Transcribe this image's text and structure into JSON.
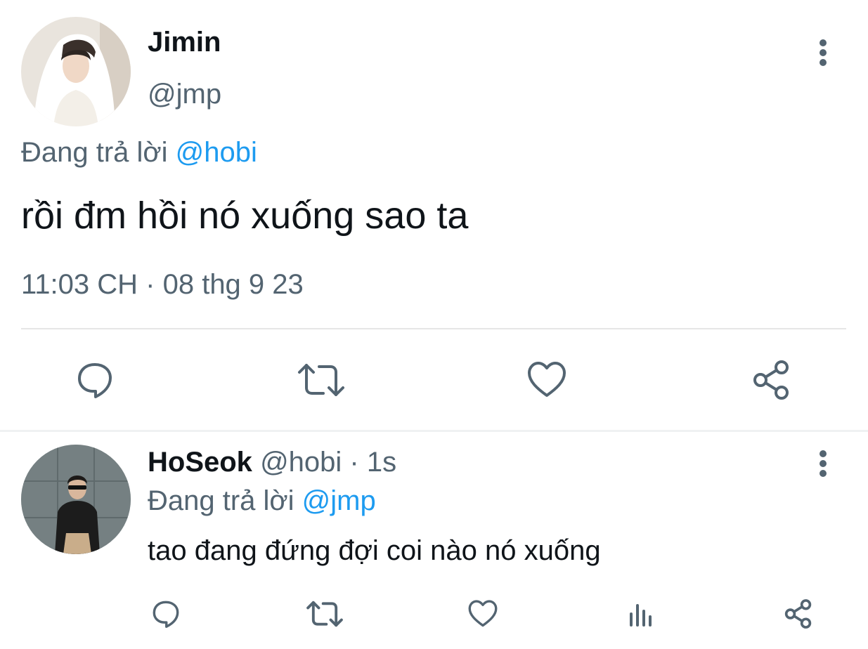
{
  "main_tweet": {
    "author_name": "Jimin",
    "handle": "@jmp",
    "reply_prefix": "Đang trả lời",
    "reply_to": "@hobi",
    "text": "rồi đm hồi nó xuống sao ta",
    "time": "11:03 CH",
    "separator": "·",
    "date": "08 thg 9 23",
    "actions": [
      "reply-icon",
      "retweet-icon",
      "like-icon",
      "share-icon"
    ]
  },
  "reply_tweet": {
    "author_name": "HoSeok",
    "handle": "@hobi",
    "age": "· 1s",
    "reply_prefix": "Đang trả lời",
    "reply_to": "@jmp",
    "text": "tao đang đứng đợi coi nào nó xuống",
    "actions": [
      "reply-icon",
      "retweet-icon",
      "like-icon",
      "views-icon",
      "share-icon"
    ]
  },
  "colors": {
    "text": "#0f1419",
    "muted": "#536471",
    "link": "#1d9bf0",
    "divider": "#e6e6e6",
    "icon": "#536471"
  }
}
